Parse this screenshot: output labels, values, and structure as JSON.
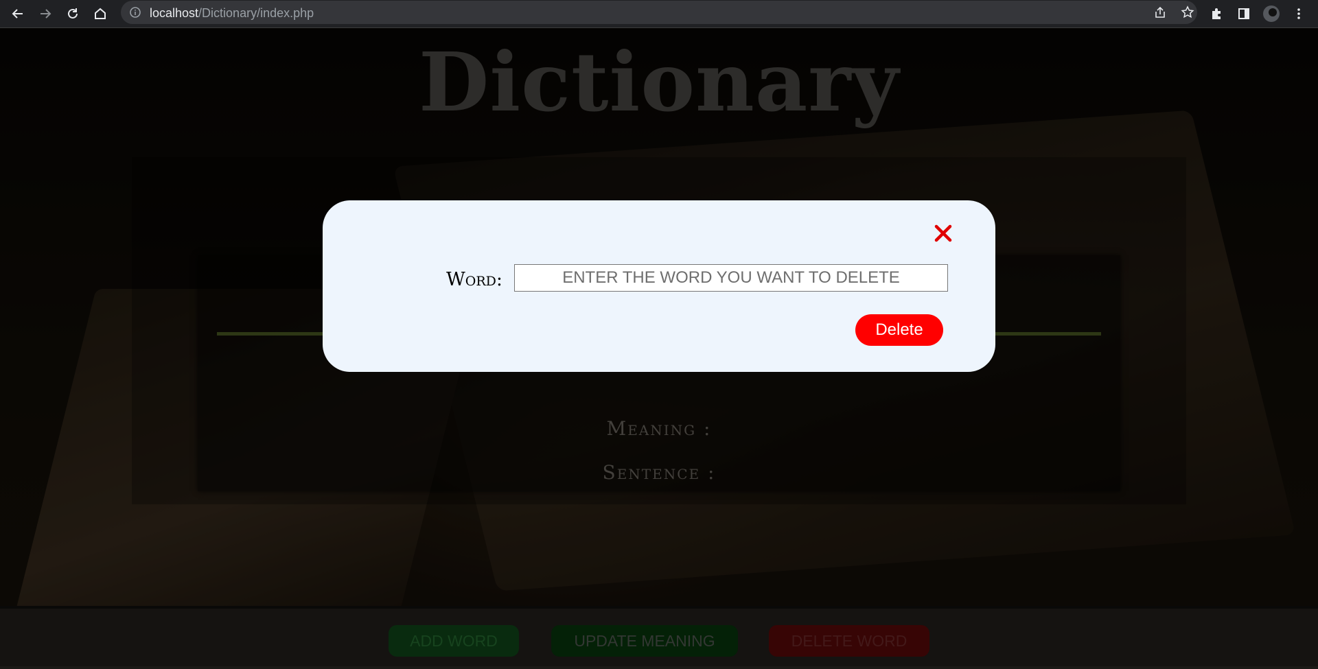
{
  "browser": {
    "url_host": "localhost",
    "url_path": "/Dictionary/index.php"
  },
  "page": {
    "title": "Dictionary",
    "colon": ":",
    "meaning_label": "Meaning :",
    "sentence_label": "Sentence :"
  },
  "bottom_bar": {
    "add_word": "ADD WORD",
    "update_meaning": "UPDATE MEANING",
    "delete_word": "DELETE WORD"
  },
  "modal": {
    "word_label": "Word:",
    "word_placeholder": "ENTER THE WORD YOU WANT TO DELETE",
    "word_value": "",
    "delete_button": "Delete",
    "close_icon": "close-x-icon"
  },
  "colors": {
    "modal_bg": "#eef5fd",
    "delete_red": "#ff0000",
    "close_red": "#e00000"
  }
}
